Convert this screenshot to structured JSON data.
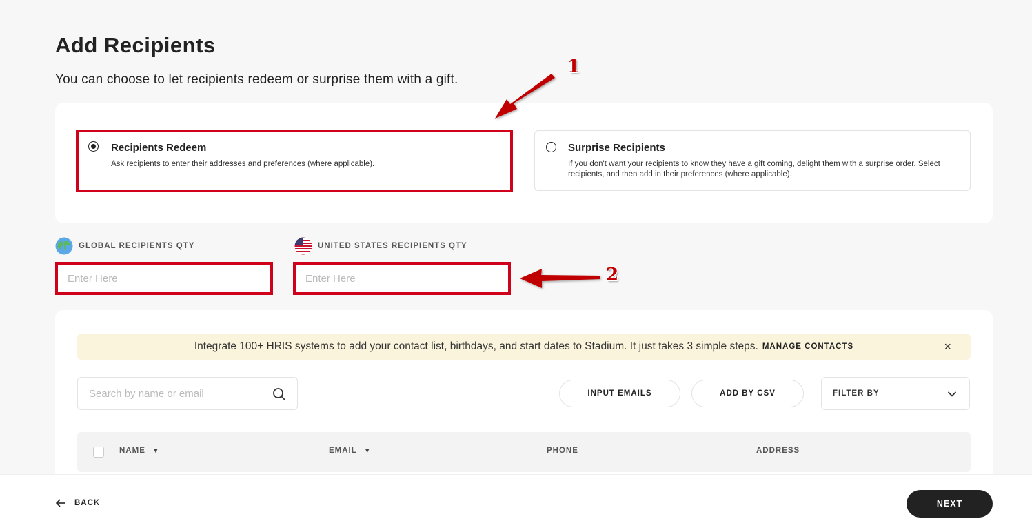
{
  "page": {
    "title": "Add Recipients",
    "subtitle": "You can choose to let recipients redeem or surprise them with a gift."
  },
  "options": [
    {
      "title": "Recipients Redeem",
      "description": "Ask recipients to enter their addresses and preferences (where applicable).",
      "selected": true
    },
    {
      "title": "Surprise Recipients",
      "description": "If you don't want your recipients to know they have a gift coming, delight them with a surprise order. Select recipients, and then add in their preferences (where applicable).",
      "selected": false
    }
  ],
  "quantities": {
    "global_label": "GLOBAL RECIPIENTS QTY",
    "global_placeholder": "Enter Here",
    "us_label": "UNITED STATES RECIPIENTS QTY",
    "us_placeholder": "Enter Here"
  },
  "banner": {
    "text": "Integrate 100+ HRIS systems to add your contact list, birthdays, and start dates to Stadium. It just takes 3 simple steps.",
    "link": "MANAGE CONTACTS",
    "close": "×"
  },
  "toolbar": {
    "search_placeholder": "Search by name or email",
    "input_emails": "INPUT EMAILS",
    "add_by_csv": "ADD BY CSV",
    "filter_by": "FILTER BY"
  },
  "table": {
    "columns": [
      "NAME",
      "EMAIL",
      "PHONE",
      "ADDRESS"
    ]
  },
  "footer": {
    "back": "BACK",
    "next": "NEXT"
  },
  "annotations": {
    "one": "1",
    "two": "2"
  },
  "colors": {
    "highlight": "#d0021b",
    "annotation_arrow": "#c00000",
    "banner_bg": "#fbf4dc",
    "primary_button": "#222222"
  },
  "icons": {
    "globe": "globe-icon",
    "flag": "us-flag-icon",
    "search": "search-icon",
    "close": "close-icon",
    "chevron": "chevron-down-icon",
    "sort": "sort-down-icon",
    "back": "arrow-left-icon"
  }
}
